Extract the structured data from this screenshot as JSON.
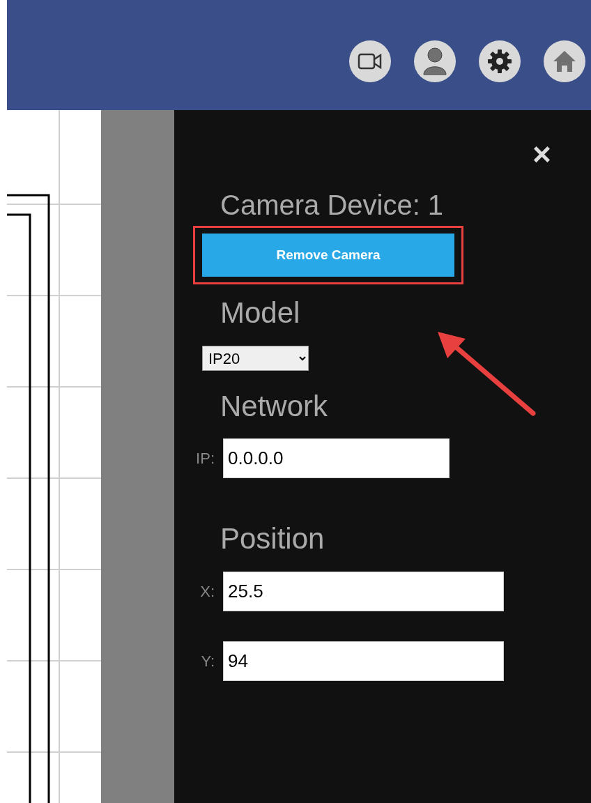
{
  "header": {
    "icons": [
      {
        "kind": "camera"
      },
      {
        "kind": "user"
      },
      {
        "kind": "settings"
      },
      {
        "kind": "home"
      }
    ]
  },
  "panel": {
    "close": "×",
    "title": "Camera Device: 1",
    "remove_button": "Remove Camera",
    "model": {
      "heading": "Model",
      "value": "IP20"
    },
    "network": {
      "heading": "Network",
      "fields": [
        {
          "label": "IP:",
          "value": "0.0.0.0"
        }
      ]
    },
    "position": {
      "heading": "Position",
      "fields": [
        {
          "label": "X:",
          "value": "25.5"
        },
        {
          "label": "Y:",
          "value": "94"
        }
      ]
    }
  }
}
